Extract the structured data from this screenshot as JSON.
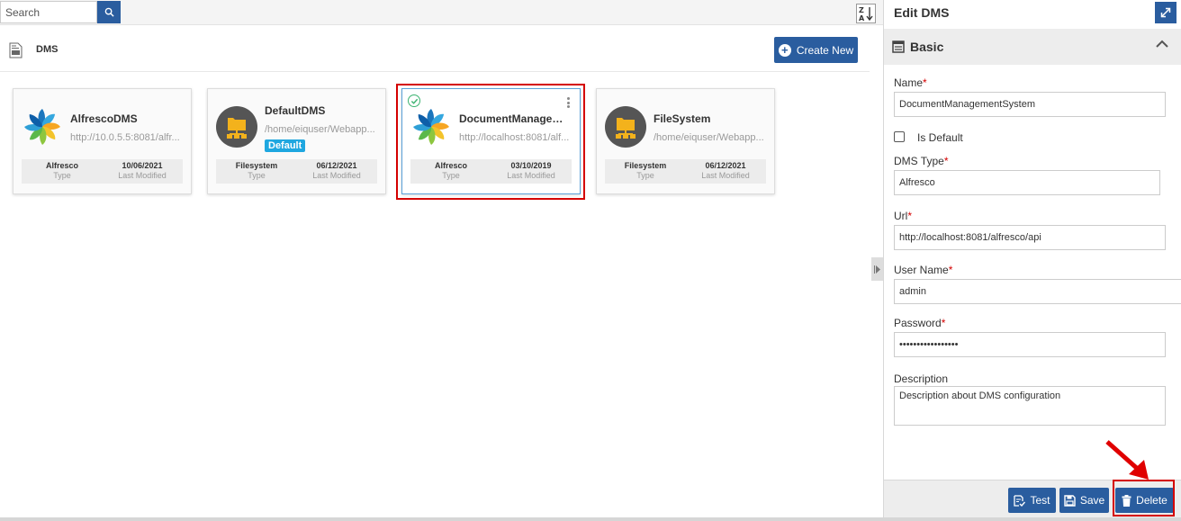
{
  "search": {
    "placeholder": "Search"
  },
  "header": {
    "title": "DMS",
    "create_label": "Create New"
  },
  "cards": [
    {
      "name": "AlfrescoDMS",
      "url": "http://10.0.5.5:8081/alfr...",
      "type": "Alfresco",
      "type_label": "Type",
      "modified": "10/06/2021",
      "modified_label": "Last Modified",
      "icon": "alfresco-logo"
    },
    {
      "name": "DefaultDMS",
      "url": "/home/eiquser/Webapp...",
      "badge": "Default",
      "type": "Filesystem",
      "type_label": "Type",
      "modified": "06/12/2021",
      "modified_label": "Last Modified",
      "icon": "folder-network"
    },
    {
      "name": "DocumentManageme...",
      "url": "http://localhost:8081/alf...",
      "type": "Alfresco",
      "type_label": "Type",
      "modified": "03/10/2019",
      "modified_label": "Last Modified",
      "icon": "alfresco-logo",
      "selected": true
    },
    {
      "name": "FileSystem",
      "url": "/home/eiquser/Webapp...",
      "type": "Filesystem",
      "type_label": "Type",
      "modified": "06/12/2021",
      "modified_label": "Last Modified",
      "icon": "folder-network"
    }
  ],
  "panel": {
    "title": "Edit DMS",
    "section": "Basic",
    "name_label": "Name",
    "name_value": "DocumentManagementSystem",
    "is_default_label": "Is Default",
    "dms_type_label": "DMS Type",
    "dms_type_value": "Alfresco",
    "url_label": "Url",
    "url_value": "http://localhost:8081/alfresco/api",
    "username_label": "User Name",
    "username_value": "admin",
    "password_label": "Password",
    "password_value": "•••••••••••••••••",
    "description_label": "Description",
    "description_value": "Description about DMS configuration",
    "required_mark": "*"
  },
  "footer": {
    "test_label": "Test",
    "save_label": "Save",
    "delete_label": "Delete"
  },
  "colors": {
    "primary": "#2a5d9f",
    "badge": "#1fa7e0",
    "highlight": "#d40000",
    "success": "#3cb371"
  }
}
